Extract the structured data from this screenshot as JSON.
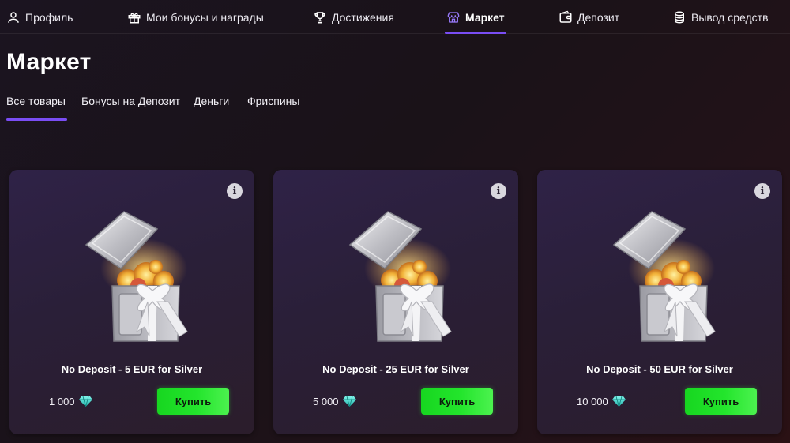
{
  "nav": {
    "items": [
      {
        "label": "Профиль",
        "icon": "user-icon"
      },
      {
        "label": "Мои бонусы и награды",
        "icon": "gift-icon"
      },
      {
        "label": "Достижения",
        "icon": "trophy-icon"
      },
      {
        "label": "Маркет",
        "icon": "shop-icon",
        "active": true
      },
      {
        "label": "Депозит",
        "icon": "wallet-icon"
      },
      {
        "label": "Вывод средств",
        "icon": "coins-icon"
      }
    ]
  },
  "page": {
    "title": "Маркет"
  },
  "tabs": [
    {
      "label": "Все товары",
      "active": true
    },
    {
      "label": "Бонусы на Депозит"
    },
    {
      "label": "Деньги"
    },
    {
      "label": "Фриспины"
    }
  ],
  "products": [
    {
      "title": "No Deposit - 5 EUR for Silver",
      "price": "1 000",
      "currency_icon": "diamond-icon",
      "buy_label": "Купить",
      "image": "silver-chest"
    },
    {
      "title": "No Deposit - 25 EUR for Silver",
      "price": "5 000",
      "currency_icon": "diamond-icon",
      "buy_label": "Купить",
      "image": "silver-chest"
    },
    {
      "title": "No Deposit - 50 EUR for Silver",
      "price": "10 000",
      "currency_icon": "diamond-icon",
      "buy_label": "Купить",
      "image": "silver-chest"
    }
  ],
  "colors": {
    "accent": "#7a4df4",
    "buy_button": "#23e52c",
    "card_bg": "#2c203f",
    "diamond": "#2fd3c8"
  }
}
